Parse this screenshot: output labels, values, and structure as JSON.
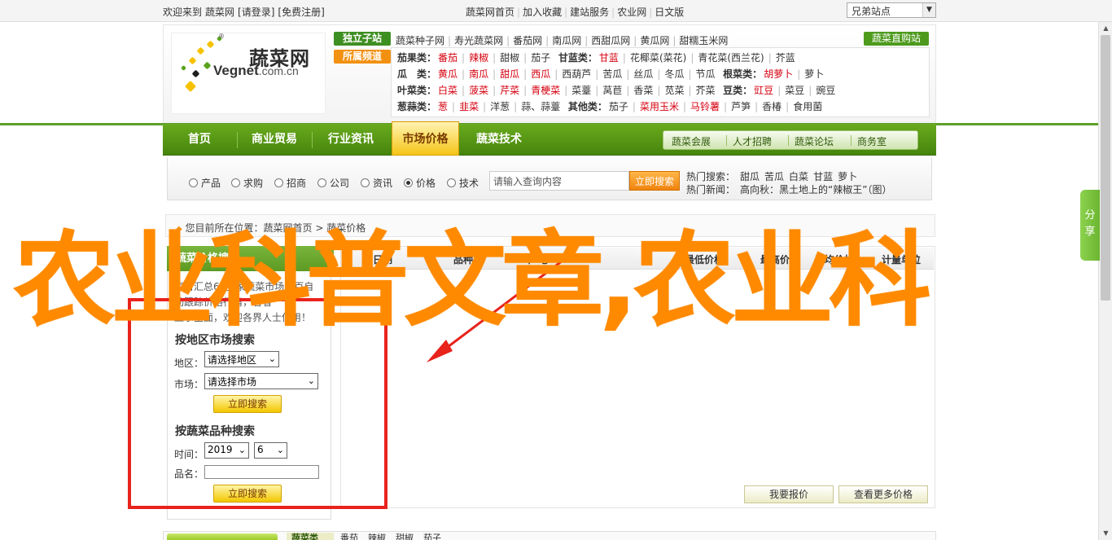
{
  "topbar": {
    "welcome": "欢迎来到",
    "site_name": "蔬菜网",
    "login": "[请登录]",
    "register": "[免费注册]",
    "links": [
      "蔬菜网首页",
      "加入收藏",
      "建站服务",
      "农业网",
      "日文版"
    ],
    "site_select": "兄弟站点"
  },
  "logo": {
    "cn": "蔬菜网",
    "en": "Vegnet",
    "en_suffix": ".com.cn",
    "registered": "®"
  },
  "categories": {
    "tag_independent": "独立子站",
    "tag_affiliate": "所属频道",
    "shop_button": "蔬菜直购站",
    "row0": [
      "蔬菜种子网",
      "寿光蔬菜网",
      "番茄网",
      "南瓜网",
      "西甜瓜网",
      "黄瓜网",
      "甜糯玉米网"
    ],
    "rows": [
      {
        "groups": [
          {
            "label": "茄果类：",
            "items": [
              {
                "t": "番茄",
                "red": true
              },
              {
                "t": "辣椒",
                "red": true
              },
              {
                "t": "甜椒",
                "red": false
              },
              {
                "t": "茄子",
                "red": false
              }
            ]
          },
          {
            "label": "甘蓝类：",
            "items": [
              {
                "t": "甘蓝",
                "red": true
              },
              {
                "t": "花椰菜(菜花)",
                "red": false
              },
              {
                "t": "青花菜(西兰花)",
                "red": false
              },
              {
                "t": "芥蓝",
                "red": false
              }
            ]
          }
        ]
      },
      {
        "groups": [
          {
            "label": "瓜　类：",
            "items": [
              {
                "t": "黄瓜",
                "red": true
              },
              {
                "t": "南瓜",
                "red": true
              },
              {
                "t": "甜瓜",
                "red": true
              },
              {
                "t": "西瓜",
                "red": true
              },
              {
                "t": "西葫芦",
                "red": false
              },
              {
                "t": "苦瓜",
                "red": false
              },
              {
                "t": "丝瓜",
                "red": false
              },
              {
                "t": "冬瓜",
                "red": false
              },
              {
                "t": "节瓜",
                "red": false
              }
            ]
          },
          {
            "label": "根菜类：",
            "items": [
              {
                "t": "胡萝卜",
                "red": true
              },
              {
                "t": "萝卜",
                "red": false
              }
            ]
          }
        ]
      },
      {
        "groups": [
          {
            "label": "叶菜类：",
            "items": [
              {
                "t": "白菜",
                "red": true
              },
              {
                "t": "菠菜",
                "red": true
              },
              {
                "t": "芹菜",
                "red": true
              },
              {
                "t": "青梗菜",
                "red": true
              },
              {
                "t": "菜薹",
                "red": false
              },
              {
                "t": "莴苣",
                "red": false
              },
              {
                "t": "香菜",
                "red": false
              },
              {
                "t": "苋菜",
                "red": false
              },
              {
                "t": "芥菜",
                "red": false
              }
            ]
          },
          {
            "label": "豆类：",
            "items": [
              {
                "t": "豇豆",
                "red": true
              },
              {
                "t": "菜豆",
                "red": false
              },
              {
                "t": "豌豆",
                "red": false
              }
            ]
          }
        ]
      },
      {
        "groups": [
          {
            "label": "葱蒜类：",
            "items": [
              {
                "t": "葱",
                "red": true
              },
              {
                "t": "韭菜",
                "red": true
              },
              {
                "t": "洋葱",
                "red": false
              },
              {
                "t": "蒜、蒜薹",
                "red": false
              }
            ]
          },
          {
            "label": "其他类：",
            "items": [
              {
                "t": "茄子",
                "red": false
              },
              {
                "t": "菜用玉米",
                "red": true
              },
              {
                "t": "马铃薯",
                "red": true
              },
              {
                "t": "芦笋",
                "red": false
              },
              {
                "t": "香椿",
                "red": false
              },
              {
                "t": "食用菌",
                "red": false
              }
            ]
          }
        ]
      }
    ]
  },
  "nav": {
    "items": [
      "首页",
      "商业贸易",
      "行业资讯",
      "市场价格",
      "蔬菜技术"
    ],
    "active_index": 3,
    "sub": [
      "蔬菜会展",
      "人才招聘",
      "蔬菜论坛",
      "商务室"
    ]
  },
  "search": {
    "options": [
      "产品",
      "求购",
      "招商",
      "公司",
      "资讯",
      "价格",
      "技术"
    ],
    "selected_index": 5,
    "placeholder": "请输入查询内容",
    "button": "立即搜索",
    "hot_label": "热门搜索：",
    "hot_items": [
      "甜瓜",
      "苦瓜",
      "白菜",
      "甘蓝",
      "萝卜"
    ],
    "news_label": "热门新闻：",
    "news_text": "高向秋：黑土地上的“辣椒王”（图）"
  },
  "breadcrumb": {
    "prefix": "您目前所在位置：",
    "home": "蔬菜网首页",
    "sep": ">",
    "current": "蔬菜价格"
  },
  "left_panel": {
    "title": "蔬菜价格搜索",
    "intro_lines": [
      "每日汇总60多家蔬菜市场，百自",
      "动跟踪价格行情，看看",
      "显示全面，欢迎各界人士使用！"
    ],
    "region_title": "按地区市场搜索",
    "region_label": "地区：",
    "region_value": "请选择地区",
    "market_label": "市场：",
    "market_value": "请选择市场",
    "search_button": "立即搜索",
    "variety_title": "按蔬菜品种搜索",
    "time_label": "时间：",
    "year_value": "2019",
    "month_value": "6",
    "name_label": "品名：",
    "search_button2": "立即搜索"
  },
  "price_table": {
    "headers": [
      "日期",
      "品种",
      "产地",
      "最低价格",
      "最高价格",
      "平均价格",
      "计量单位"
    ],
    "quote_button": "我要报价",
    "more_button": "查看更多价格"
  },
  "bottom": {
    "label": "蔬菜类",
    "items": [
      "番茄",
      "辣椒",
      "甜椒",
      "茄子"
    ]
  },
  "share_tab": {
    "line1": "分",
    "line2": "享"
  },
  "overlay": {
    "title": "农业科普文章,农业科",
    "highlight_color": "#e8231c",
    "title_color": "#ff8a00"
  },
  "scrollbar": {
    "up": "▲",
    "down": "▼"
  }
}
